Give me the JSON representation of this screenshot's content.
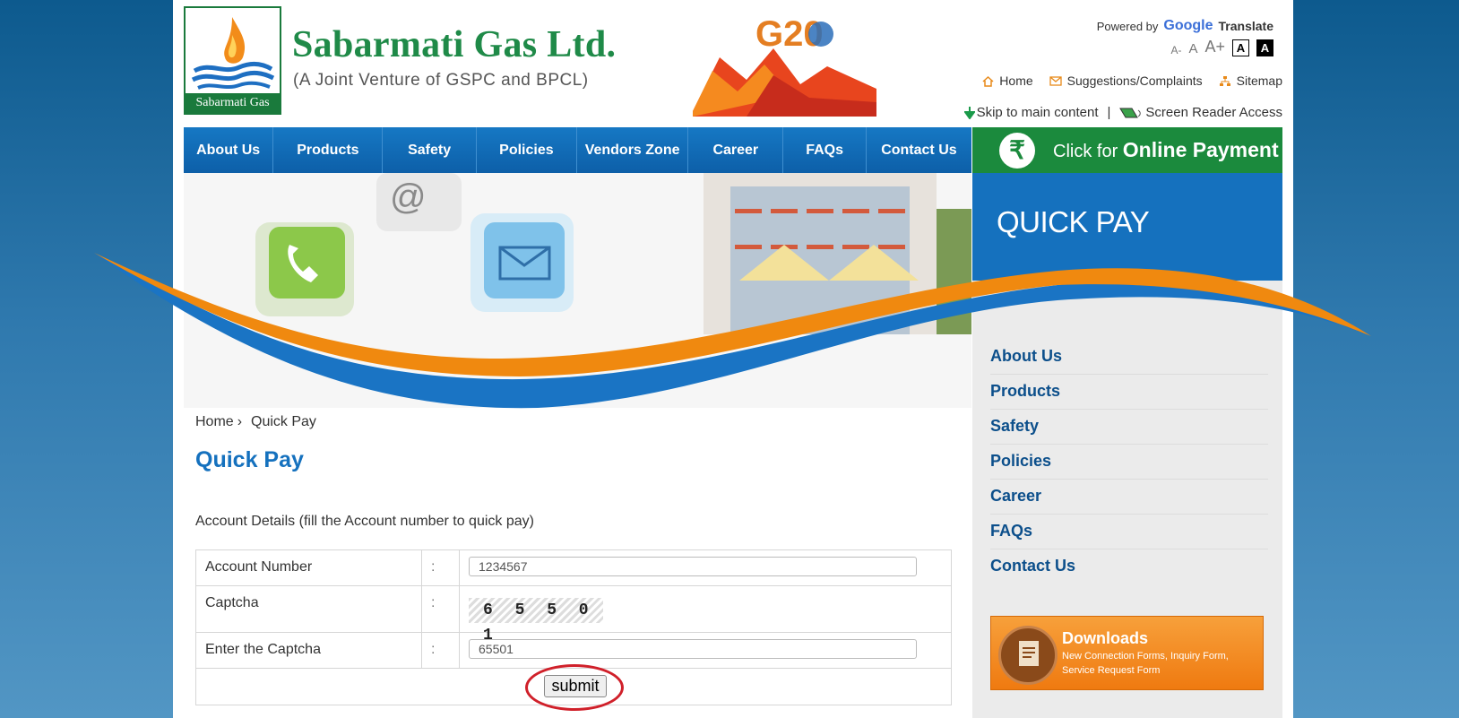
{
  "header": {
    "logo_caption": "Sabarmati Gas",
    "brand_title": "Sabarmati Gas Ltd.",
    "brand_subtitle": "(A Joint Venture of GSPC and BPCL)",
    "g20_text": "G20",
    "powered_by": "Powered by",
    "google": "Google",
    "translate": "Translate",
    "font_small": "A-",
    "font_normal": "A",
    "font_large": "A+",
    "contrast_light": "A",
    "contrast_dark": "A",
    "home_link": "Home",
    "suggestions_link": "Suggestions/Complaints",
    "sitemap_link": "Sitemap",
    "skip_link": "Skip to main content",
    "separator": "|",
    "screen_reader_link": "Screen Reader Access"
  },
  "nav": {
    "items": [
      "About Us",
      "Products",
      "Safety",
      "Policies",
      "Vendors Zone",
      "Career",
      "FAQs",
      "Contact Us"
    ],
    "payment_pre": "Click for",
    "payment_main": "Online Payment",
    "rupee": "₹"
  },
  "sidebar": {
    "heading": "QUICK PAY",
    "items": [
      "About Us",
      "Products",
      "Safety",
      "Policies",
      "Career",
      "FAQs",
      "Contact Us"
    ],
    "downloads_title": "Downloads",
    "downloads_desc": "New Connection Forms, Inquiry Form, Service Request Form"
  },
  "content": {
    "breadcrumb_home": "Home",
    "breadcrumb_sep": "›",
    "breadcrumb_current": "Quick Pay",
    "title": "Quick Pay",
    "description": "Account Details (fill the Account number to quick pay)",
    "form": {
      "account_label": "Account Number",
      "account_value": "1234567",
      "captcha_label": "Captcha",
      "captcha_text": "6 5 5 0 1",
      "enter_captcha_label": "Enter the Captcha",
      "enter_captcha_value": "65501",
      "colon": ":",
      "submit_label": "submit"
    }
  },
  "colors": {
    "brand_green": "#1f8a48",
    "nav_blue": "#1571be",
    "accent_orange": "#ef8a12",
    "highlight_red": "#d0202a"
  }
}
